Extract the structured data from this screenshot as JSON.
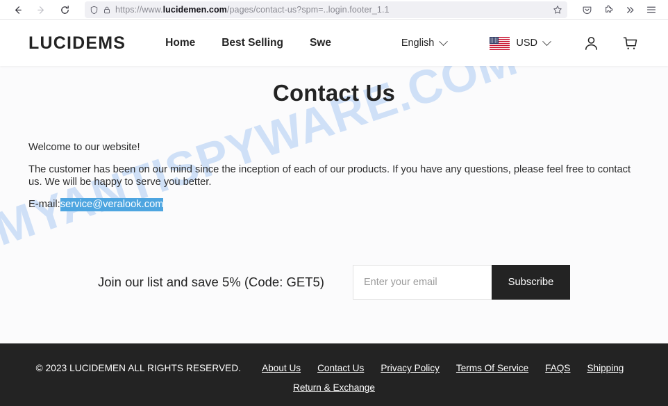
{
  "browser": {
    "back_icon": "arrow-left-icon",
    "forward_icon": "arrow-right-icon",
    "reload_icon": "reload-icon",
    "shield_icon": "shield-icon",
    "lock_icon": "lock-icon",
    "star_icon": "bookmark-star-icon",
    "url_prefix": "https://www.",
    "url_host": "lucidemen.com",
    "url_path": "/pages/contact-us?spm=..login.footer_1.1",
    "pocket_icon": "pocket-icon",
    "extensions_icon": "puzzle-piece-icon",
    "overflow_icon": "chevron-double-right-icon",
    "menu_icon": "hamburger-menu-icon"
  },
  "header": {
    "logo": "LUCIDEMS",
    "nav": [
      {
        "label": "Home"
      },
      {
        "label": "Best Selling"
      },
      {
        "label": "Swe"
      }
    ],
    "language": {
      "label": "English",
      "chevron": "chevron-down-icon"
    },
    "currency": {
      "label": "USD",
      "flag": "us-flag-icon",
      "chevron": "chevron-down-icon"
    },
    "account_icon": "user-account-icon",
    "cart_icon": "shopping-cart-icon"
  },
  "page": {
    "title": "Contact Us",
    "watermark": "MYANTISPYWARE.COM",
    "welcome": "Welcome to our website!",
    "paragraph": "The customer has been on our mind since the inception of each of our products. If you have any questions, please feel free to contact us. We will be happy to serve you better.",
    "email_label": "E-mail:",
    "email_value": "service@veralook.com",
    "selection_color": "#4da5e0"
  },
  "subscribe": {
    "promo_text": "Join our list and save 5% (Code: GET5)",
    "input_placeholder": "Enter your email",
    "input_value": "",
    "button_label": "Subscribe",
    "button_color": "#232323"
  },
  "footer": {
    "background": "#232323",
    "copyright": "© 2023 LUCIDEMEN ALL RIGHTS RESERVED.",
    "links_row1": [
      {
        "label": "About Us"
      },
      {
        "label": "Contact Us"
      },
      {
        "label": "Privacy Policy"
      },
      {
        "label": "Terms Of Service"
      },
      {
        "label": "FAQS"
      },
      {
        "label": "Shipping"
      }
    ],
    "links_row2": [
      {
        "label": "Return & Exchange"
      }
    ]
  }
}
